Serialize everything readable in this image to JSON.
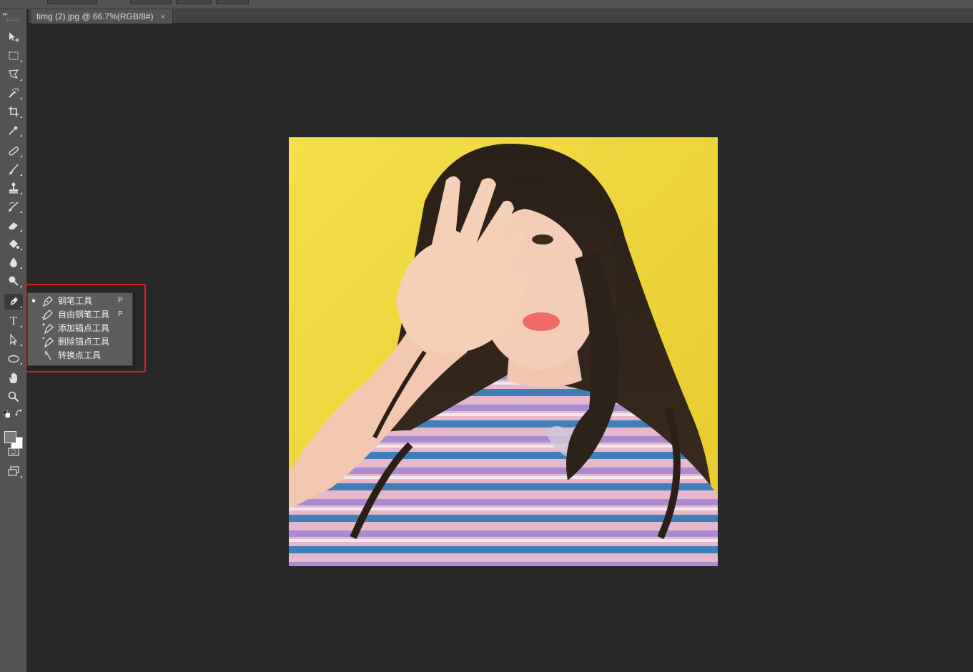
{
  "document": {
    "tab_title": "timg (2).jpg @ 66.7%(RGB/8#)",
    "close_glyph": "×"
  },
  "toolbox": {
    "tools": [
      {
        "name": "move-tool-icon"
      },
      {
        "name": "marquee-tool-icon"
      },
      {
        "name": "lasso-tool-icon"
      },
      {
        "name": "magic-wand-tool-icon"
      },
      {
        "name": "crop-tool-icon"
      },
      {
        "name": "eyedropper-tool-icon"
      },
      {
        "name": "healing-brush-tool-icon"
      },
      {
        "name": "brush-tool-icon"
      },
      {
        "name": "clone-stamp-tool-icon"
      },
      {
        "name": "history-brush-tool-icon"
      },
      {
        "name": "eraser-tool-icon"
      },
      {
        "name": "paint-bucket-tool-icon"
      },
      {
        "name": "blur-tool-icon"
      },
      {
        "name": "dodge-tool-icon"
      },
      {
        "name": "pen-tool-icon"
      },
      {
        "name": "type-tool-icon"
      },
      {
        "name": "path-selection-tool-icon"
      },
      {
        "name": "ellipse-tool-icon"
      },
      {
        "name": "hand-tool-icon"
      },
      {
        "name": "zoom-tool-icon"
      }
    ],
    "type_glyph": "T",
    "foreground_color": "#7a7a7a",
    "background_color": "#ffffff"
  },
  "flyout": {
    "items": [
      {
        "label": "钢笔工具",
        "shortcut": "P",
        "selected": true,
        "icon": "pen-icon"
      },
      {
        "label": "自由钢笔工具",
        "shortcut": "P",
        "selected": false,
        "icon": "freeform-pen-icon"
      },
      {
        "label": "添加锚点工具",
        "shortcut": "",
        "selected": false,
        "icon": "add-anchor-point-icon"
      },
      {
        "label": "删除锚点工具",
        "shortcut": "",
        "selected": false,
        "icon": "delete-anchor-point-icon"
      },
      {
        "label": "转换点工具",
        "shortcut": "",
        "selected": false,
        "icon": "convert-point-icon"
      }
    ],
    "selected_marker": "■",
    "highlight_color": "#e02020"
  },
  "colors": {
    "workspace": "#282828",
    "panel": "#535353",
    "photo_background": "#f2dc3c"
  }
}
